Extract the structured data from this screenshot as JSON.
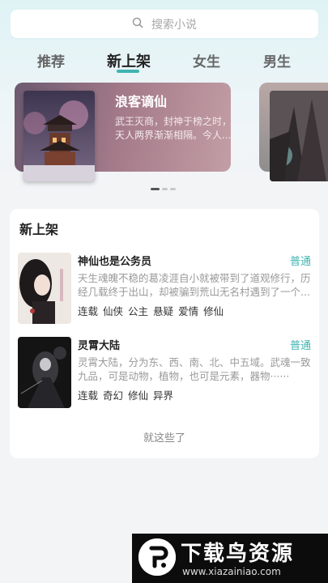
{
  "search": {
    "placeholder": "搜索小说"
  },
  "tabs": [
    {
      "label": "推荐"
    },
    {
      "label": "新上架",
      "active": true
    },
    {
      "label": "女生"
    },
    {
      "label": "男生"
    }
  ],
  "banner": {
    "title": "浪客谪仙",
    "description": "武王灭商，封神于榜之时，天人两界渐渐相隔。今人..."
  },
  "carousel_page": {
    "current": 1,
    "total": 3
  },
  "section": {
    "title": "新上架",
    "books": [
      {
        "title": "神仙也是公务员",
        "badge": "普通",
        "description": "天生魂魄不稳的葛凌涯自小就被带到了道观修行，历经几载终于出山，却被骗到荒山无名村遇到了一个...",
        "tags": [
          "连载",
          "仙侠",
          "公主",
          "悬疑",
          "爱情",
          "修仙"
        ]
      },
      {
        "title": "灵霄大陆",
        "badge": "普通",
        "description": "灵霄大陆，分为东、西、南、北、中五域。武魂一致九品，可是动物，植物，也可是元素，器物······",
        "tags": [
          "连载",
          "奇幻",
          "修仙",
          "异界"
        ]
      }
    ],
    "end_text": "就这些了"
  },
  "watermark": {
    "title": "下载鸟资源",
    "url": "www.xiazainiao.com"
  },
  "colors": {
    "accent": "#3fb4b0",
    "badge": "#3fb4b0"
  }
}
